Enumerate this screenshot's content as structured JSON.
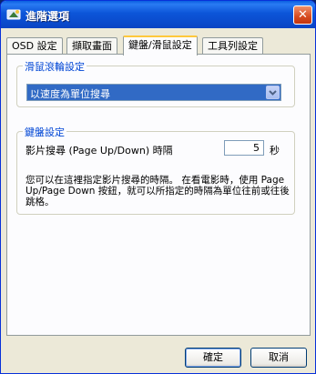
{
  "window": {
    "title": "進階選項",
    "close_label": "✕"
  },
  "tabs": [
    {
      "label": "OSD 設定",
      "active": false
    },
    {
      "label": "擷取畫面",
      "active": false
    },
    {
      "label": "鍵盤/滑鼠設定",
      "active": true
    },
    {
      "label": "工具列設定",
      "active": false
    }
  ],
  "mouse_group": {
    "label": "滑鼠滾輪設定",
    "select_value": "以速度為單位搜尋"
  },
  "keyboard_group": {
    "label": "鍵盤設定",
    "seek_label": "影片搜尋 (Page Up/Down) 時隔",
    "seek_value": "5",
    "seek_unit": "秒",
    "description": "您可以在這裡指定影片搜尋的時隔。 在看電影時，使用 Page Up/Page Down 按鈕，就可以所指定的時隔為單位往前或往後跳格。"
  },
  "buttons": {
    "ok": "確定",
    "cancel": "取消"
  },
  "colors": {
    "titlebar": "#0b4ed0",
    "group_label": "#0046d5",
    "selection": "#316ac5",
    "close_button": "#d64a1f"
  }
}
